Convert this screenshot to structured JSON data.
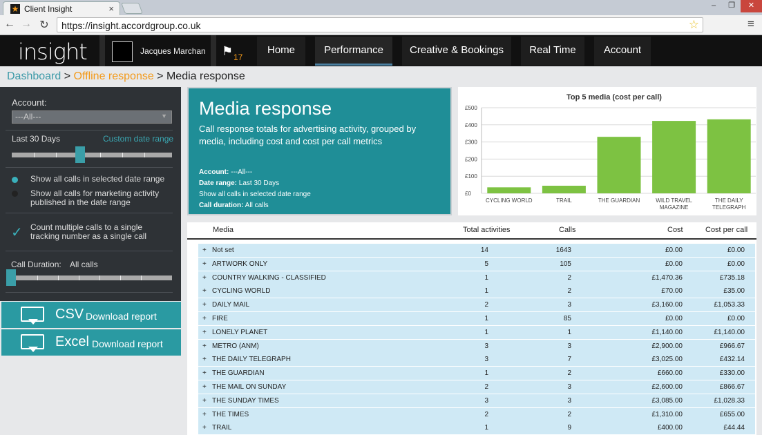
{
  "browser": {
    "tab_title": "Client Insight",
    "tab_close": "×",
    "url": "https://insight.accordgroup.co.uk",
    "win_min": "–",
    "win_max": "❐",
    "win_close": "✕"
  },
  "header": {
    "logo": "insight",
    "user_name": "Jacques Marchan",
    "flag_count": "17",
    "nav": [
      "Home",
      "Performance",
      "Creative & Bookings",
      "Real Time",
      "Account"
    ],
    "active_nav": "Performance"
  },
  "breadcrumb": {
    "dashboard": "Dashboard",
    "sep1": " > ",
    "offline": "Offline response",
    "sep2": " > ",
    "current": "Media response"
  },
  "sidebar": {
    "account_label": "Account:",
    "account_value": "---All---",
    "date_label": "Last 30 Days",
    "custom_range": "Custom date range",
    "radio1": "Show all calls in selected date range",
    "radio2_line1": "Show all calls for marketing activity",
    "radio2_line2": "published in the date range",
    "checkbox_line1": "Count multiple calls to a single",
    "checkbox_line2": "tracking number as a single call",
    "duration_label": "Call Duration:",
    "duration_value": "All calls",
    "csv_big": "CSV",
    "csv_small": "Download report",
    "excel_big": "Excel",
    "excel_small": "Download report"
  },
  "hero": {
    "title": "Media response",
    "description": "Call response totals for advertising activity, grouped by media, including cost and cost per call metrics",
    "meta_account_label": "Account:",
    "meta_account_value": " ---All---",
    "meta_range_label": "Date range:",
    "meta_range_value": " Last 30 Days",
    "meta_mode": "Show all calls in selected date range",
    "meta_duration_label": "Call duration:",
    "meta_duration_value": " All calls"
  },
  "chart_data": {
    "type": "bar",
    "title": "Top 5 media (cost per call)",
    "categories": [
      [
        "CYCLING WORLD"
      ],
      [
        "TRAIL"
      ],
      [
        "THE GUARDIAN"
      ],
      [
        "WILD TRAVEL",
        "MAGAZINE"
      ],
      [
        "THE DAILY",
        "TELEGRAPH"
      ]
    ],
    "values": [
      35,
      44.44,
      330,
      423,
      432.14
    ],
    "ylim": [
      0,
      500
    ],
    "yticks": [
      "£0",
      "£100",
      "£200",
      "£300",
      "£400",
      "£500"
    ],
    "bar_color": "#7dc242",
    "grid": true
  },
  "table": {
    "headers": [
      "Media",
      "Total activities",
      "Calls",
      "Cost",
      "Cost per call"
    ],
    "expand_symbol": "+",
    "rows": [
      [
        "Not set",
        "14",
        "1643",
        "£0.00",
        "£0.00"
      ],
      [
        "ARTWORK ONLY",
        "5",
        "105",
        "£0.00",
        "£0.00"
      ],
      [
        "COUNTRY WALKING - CLASSIFIED",
        "1",
        "2",
        "£1,470.36",
        "£735.18"
      ],
      [
        "CYCLING WORLD",
        "1",
        "2",
        "£70.00",
        "£35.00"
      ],
      [
        "DAILY MAIL",
        "2",
        "3",
        "£3,160.00",
        "£1,053.33"
      ],
      [
        "FIRE",
        "1",
        "85",
        "£0.00",
        "£0.00"
      ],
      [
        "LONELY PLANET",
        "1",
        "1",
        "£1,140.00",
        "£1,140.00"
      ],
      [
        "METRO (ANM)",
        "3",
        "3",
        "£2,900.00",
        "£966.67"
      ],
      [
        "THE DAILY TELEGRAPH",
        "3",
        "7",
        "£3,025.00",
        "£432.14"
      ],
      [
        "THE GUARDIAN",
        "1",
        "2",
        "£660.00",
        "£330.00"
      ],
      [
        "THE MAIL ON SUNDAY",
        "2",
        "3",
        "£2,600.00",
        "£866.67"
      ],
      [
        "THE SUNDAY TIMES",
        "3",
        "3",
        "£3,085.00",
        "£1,028.33"
      ],
      [
        "THE TIMES",
        "2",
        "2",
        "£1,310.00",
        "£655.00"
      ],
      [
        "TRAIL",
        "1",
        "9",
        "£400.00",
        "£44.44"
      ]
    ]
  },
  "colors": {
    "teal": "#1f8e97",
    "orange": "#f39a1b",
    "row_bg": "#cfe9f5"
  }
}
